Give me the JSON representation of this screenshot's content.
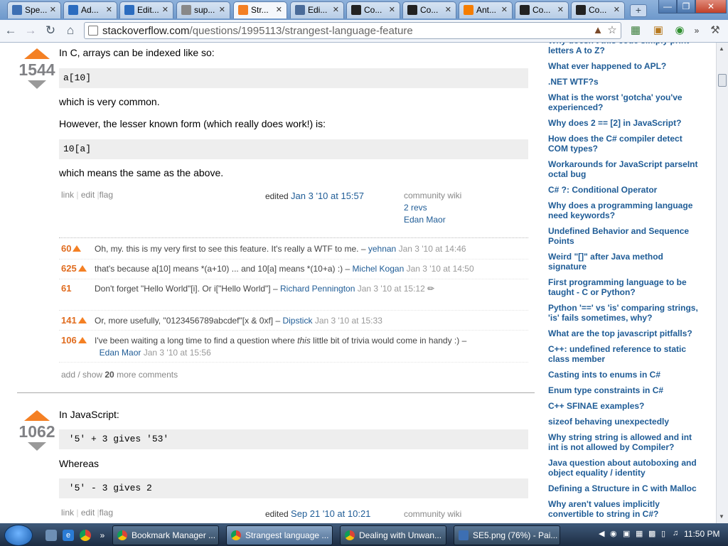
{
  "browser": {
    "tabs": [
      {
        "label": "Spe...",
        "icon": "sheet-icon",
        "color": "#3d6fb3"
      },
      {
        "label": "Ad...",
        "icon": "amazon-icon",
        "color": "#2b6cbf"
      },
      {
        "label": "Edit...",
        "icon": "amazon-icon",
        "color": "#2b6cbf"
      },
      {
        "label": "sup...",
        "icon": "gear-icon",
        "color": "#888888"
      },
      {
        "label": "Str...",
        "icon": "stackoverflow-icon",
        "color": "#f48024"
      },
      {
        "label": "Edi...",
        "icon": "stackexchange-icon",
        "color": "#4a6b99"
      },
      {
        "label": "Co...",
        "icon": "avatar-icon",
        "color": "#222222"
      },
      {
        "label": "Co...",
        "icon": "avatar-icon",
        "color": "#222222"
      },
      {
        "label": "Ant...",
        "icon": "blogger-icon",
        "color": "#f57d00"
      },
      {
        "label": "Co...",
        "icon": "avatar-icon",
        "color": "#222222"
      },
      {
        "label": "Co...",
        "icon": "avatar-icon",
        "color": "#222222"
      }
    ],
    "url_host": "stackoverflow.com",
    "url_path": "/questions/1995113/strangest-language-feature"
  },
  "answer1": {
    "votes": "1544",
    "intro": "In C, arrays can be indexed like so:",
    "code1": "a[10]",
    "text2": "which is very common.",
    "text3": "However, the lesser known form (which really does work!) is:",
    "code2": "10[a]",
    "text4": "which means the same as the above.",
    "menu": {
      "link": "link",
      "edit": "edit",
      "flag": "flag"
    },
    "edited_label": "edited",
    "edited_date": "Jan 3 '10 at 15:57",
    "wiki_label": "community wiki",
    "wiki_revs": "2 revs",
    "wiki_user": "Edan Maor",
    "comments": [
      {
        "score": "60",
        "has_arrow": true,
        "text": "Oh, my. this is my very first to see this feature. It's really a WTF to me. –",
        "user": "yehnan",
        "date": "Jan 3 '10 at 14:46"
      },
      {
        "score": "625",
        "has_arrow": true,
        "text": "that's because a[10] means *(a+10) ... and 10[a] means *(10+a) :) –",
        "user": "Michel Kogan",
        "date": "Jan 3 '10 at 14:50"
      },
      {
        "score": "61",
        "has_arrow": false,
        "text": "Don't forget \"Hello World\"[i]. Or i[\"Hello World\"] –",
        "user": "Richard Pennington",
        "date": "Jan 3 '10 at 15:12"
      },
      {
        "score": "141",
        "has_arrow": true,
        "text": "Or, more usefully, \"0123456789abcdef\"[x & 0xf] –",
        "user": "Dipstick",
        "date": "Jan 3 '10 at 15:33"
      },
      {
        "score": "106",
        "has_arrow": true,
        "text_a": "I've been waiting a long time to find a question where ",
        "text_em": "this",
        "text_b": " little bit of trivia would come in handy :) –",
        "user": "Edan Maor",
        "date": "Jan 3 '10 at 15:56"
      }
    ],
    "more_comments_pre": "add / show ",
    "more_comments_count": "20",
    "more_comments_post": " more comments"
  },
  "answer2": {
    "votes": "1062",
    "intro": "In JavaScript:",
    "code1": " '5' + 3 gives '53'",
    "text2": "Whereas",
    "code2": " '5' - 3 gives 2",
    "menu": {
      "link": "link",
      "edit": "edit",
      "flag": "flag"
    },
    "edited_label": "edited",
    "edited_date": "Sep 21 '10 at 10:21",
    "wiki_label": "community wiki"
  },
  "related": [
    "Why doesn't this code simply print letters A to Z?",
    "What ever happened to APL?",
    ".NET WTF?s",
    "What is the worst 'gotcha' you've experienced?",
    "Why does 2 == [2] in JavaScript?",
    "How does the C# compiler detect COM types?",
    "Workarounds for JavaScript parseInt octal bug",
    "C# ?: Conditional Operator",
    "Why does a programming language need keywords?",
    "Undefined Behavior and Sequence Points",
    "Weird \"[]\" after Java method signature",
    "First programming language to be taught - C or Python?",
    "Python '==' vs 'is' comparing strings, 'is' fails sometimes, why?",
    "What are the top javascript pitfalls?",
    "C++: undefined reference to static class member",
    "Casting ints to enums in C#",
    "Enum type constraints in C#",
    "C++ SFINAE examples?",
    "sizeof behaving unexpectedly",
    "Why string string is allowed and int int is not allowed by Compiler?",
    "Java question about autoboxing and object equality / identity",
    "Defining a Structure in C with Malloc",
    "Why aren't values implicitly convertible to string in C#?"
  ],
  "taskbar": {
    "tasks": [
      "Bookmark Manager ...",
      "Strangest language ...",
      "Dealing with Unwan...",
      "SE5.png (76%) - Pai..."
    ],
    "clock": "11:50 PM"
  }
}
